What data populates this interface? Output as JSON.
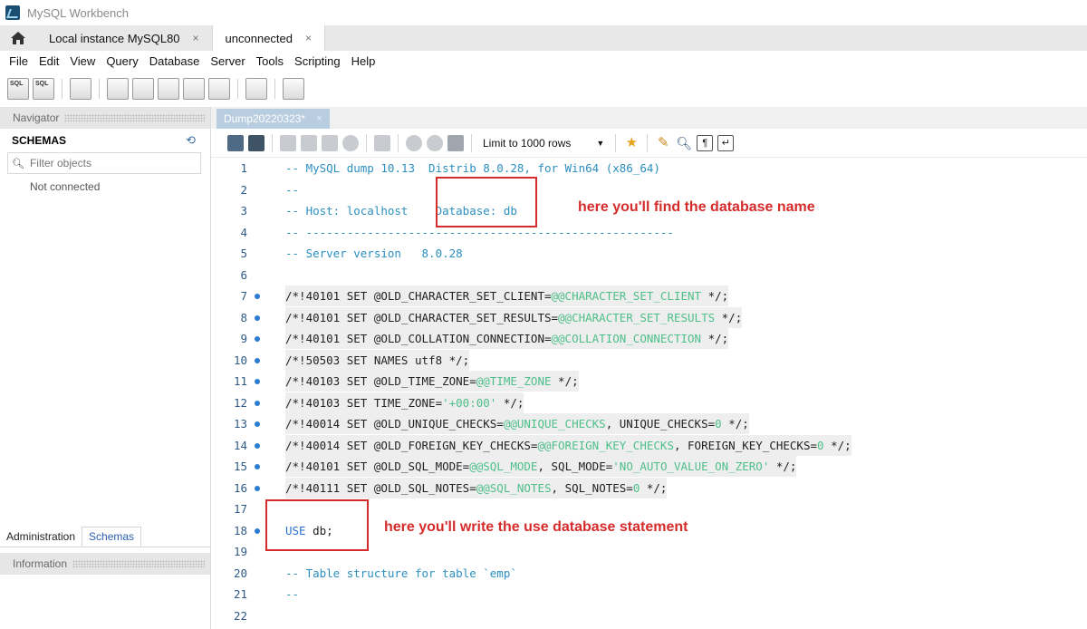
{
  "window": {
    "title": "MySQL Workbench"
  },
  "connection_tabs": [
    {
      "label": "Local instance MySQL80",
      "close": "×"
    },
    {
      "label": "unconnected",
      "close": "×"
    }
  ],
  "menu": [
    "File",
    "Edit",
    "View",
    "Query",
    "Database",
    "Server",
    "Tools",
    "Scripting",
    "Help"
  ],
  "navigator": {
    "header": "Navigator",
    "schemas_label": "SCHEMAS",
    "filter_placeholder": "Filter objects",
    "status": "Not connected",
    "bottom_tabs": [
      "Administration",
      "Schemas"
    ],
    "info_header": "Information"
  },
  "editor": {
    "tab_label": "Dump20220323*",
    "tab_close": "×",
    "limit_rows": "Limit to 1000 rows"
  },
  "code_lines": [
    {
      "n": "1",
      "marker": false,
      "tokens": [
        {
          "c": "cmt",
          "t": "-- MySQL dump 10.13  Distrib 8.0.28, for Win64 (x86_64)"
        }
      ]
    },
    {
      "n": "2",
      "marker": false,
      "tokens": [
        {
          "c": "cmt",
          "t": "--"
        }
      ]
    },
    {
      "n": "3",
      "marker": false,
      "tokens": [
        {
          "c": "cmt",
          "t": "-- Host: localhost    Database: db"
        }
      ]
    },
    {
      "n": "4",
      "marker": false,
      "tokens": [
        {
          "c": "cmt",
          "t": "-- ------------------------------------------------------"
        }
      ]
    },
    {
      "n": "5",
      "marker": false,
      "tokens": [
        {
          "c": "cmt",
          "t": "-- Server version   8.0.28"
        }
      ]
    },
    {
      "n": "6",
      "marker": false,
      "tokens": []
    },
    {
      "n": "7",
      "marker": true,
      "hl": true,
      "tokens": [
        {
          "c": "plain",
          "t": "/*!40101 SET @OLD_CHARACTER_SET_CLIENT="
        },
        {
          "c": "var",
          "t": "@@CHARACTER_SET_CLIENT"
        },
        {
          "c": "plain",
          "t": " */;"
        }
      ]
    },
    {
      "n": "8",
      "marker": true,
      "hl": true,
      "tokens": [
        {
          "c": "plain",
          "t": "/*!40101 SET @OLD_CHARACTER_SET_RESULTS="
        },
        {
          "c": "var",
          "t": "@@CHARACTER_SET_RESULTS"
        },
        {
          "c": "plain",
          "t": " */;"
        }
      ]
    },
    {
      "n": "9",
      "marker": true,
      "hl": true,
      "tokens": [
        {
          "c": "plain",
          "t": "/*!40101 SET @OLD_COLLATION_CONNECTION="
        },
        {
          "c": "var",
          "t": "@@COLLATION_CONNECTION"
        },
        {
          "c": "plain",
          "t": " */;"
        }
      ]
    },
    {
      "n": "10",
      "marker": true,
      "hl": true,
      "tokens": [
        {
          "c": "plain",
          "t": "/*!50503 SET NAMES utf8 */;"
        }
      ]
    },
    {
      "n": "11",
      "marker": true,
      "hl": true,
      "tokens": [
        {
          "c": "plain",
          "t": "/*!40103 SET @OLD_TIME_ZONE="
        },
        {
          "c": "var",
          "t": "@@TIME_ZONE"
        },
        {
          "c": "plain",
          "t": " */;"
        }
      ]
    },
    {
      "n": "12",
      "marker": true,
      "hl": true,
      "tokens": [
        {
          "c": "plain",
          "t": "/*!40103 SET TIME_ZONE="
        },
        {
          "c": "str",
          "t": "'+00:00'"
        },
        {
          "c": "plain",
          "t": " */;"
        }
      ]
    },
    {
      "n": "13",
      "marker": true,
      "hl": true,
      "tokens": [
        {
          "c": "plain",
          "t": "/*!40014 SET @OLD_UNIQUE_CHECKS="
        },
        {
          "c": "var",
          "t": "@@UNIQUE_CHECKS"
        },
        {
          "c": "plain",
          "t": ", UNIQUE_CHECKS="
        },
        {
          "c": "num",
          "t": "0"
        },
        {
          "c": "plain",
          "t": " */;"
        }
      ]
    },
    {
      "n": "14",
      "marker": true,
      "hl": true,
      "tokens": [
        {
          "c": "plain",
          "t": "/*!40014 SET @OLD_FOREIGN_KEY_CHECKS="
        },
        {
          "c": "var",
          "t": "@@FOREIGN_KEY_CHECKS"
        },
        {
          "c": "plain",
          "t": ", FOREIGN_KEY_CHECKS="
        },
        {
          "c": "num",
          "t": "0"
        },
        {
          "c": "plain",
          "t": " */;"
        }
      ]
    },
    {
      "n": "15",
      "marker": true,
      "hl": true,
      "tokens": [
        {
          "c": "plain",
          "t": "/*!40101 SET @OLD_SQL_MODE="
        },
        {
          "c": "var",
          "t": "@@SQL_MODE"
        },
        {
          "c": "plain",
          "t": ", SQL_MODE="
        },
        {
          "c": "str",
          "t": "'NO_AUTO_VALUE_ON_ZERO'"
        },
        {
          "c": "plain",
          "t": " */;"
        }
      ]
    },
    {
      "n": "16",
      "marker": true,
      "hl": true,
      "tokens": [
        {
          "c": "plain",
          "t": "/*!40111 SET @OLD_SQL_NOTES="
        },
        {
          "c": "var",
          "t": "@@SQL_NOTES"
        },
        {
          "c": "plain",
          "t": ", SQL_NOTES="
        },
        {
          "c": "num",
          "t": "0"
        },
        {
          "c": "plain",
          "t": " */;"
        }
      ]
    },
    {
      "n": "17",
      "marker": false,
      "tokens": []
    },
    {
      "n": "18",
      "marker": true,
      "tokens": [
        {
          "c": "kw",
          "t": "USE"
        },
        {
          "c": "plain",
          "t": " db;"
        }
      ]
    },
    {
      "n": "19",
      "marker": false,
      "tokens": []
    },
    {
      "n": "20",
      "marker": false,
      "tokens": [
        {
          "c": "cmt",
          "t": "-- Table structure for table `emp`"
        }
      ]
    },
    {
      "n": "21",
      "marker": false,
      "tokens": [
        {
          "c": "cmt",
          "t": "--"
        }
      ]
    },
    {
      "n": "22",
      "marker": false,
      "tokens": []
    }
  ],
  "annotations": {
    "database_note": "here you'll find the database name",
    "use_note": "here you'll write the use database statement"
  },
  "colors": {
    "annotation": "#d62b2b",
    "comment": "#2c8fbf",
    "keyword": "#2a6fd6",
    "variable": "#4fbf8a"
  }
}
